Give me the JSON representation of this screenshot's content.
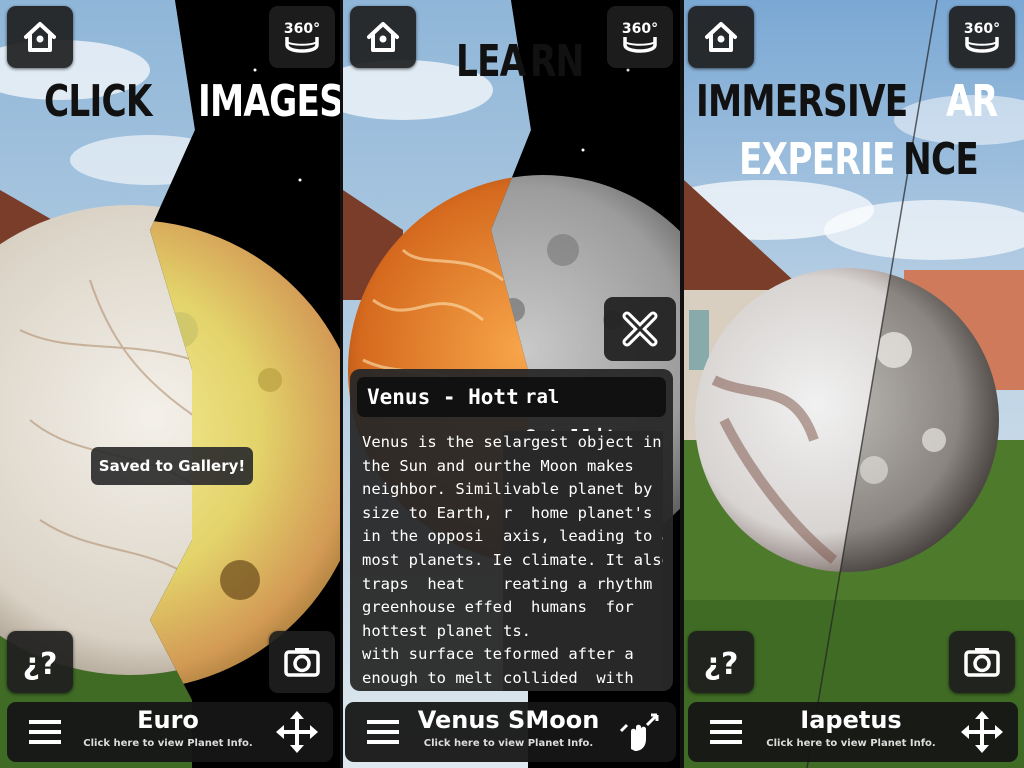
{
  "panels": [
    {
      "headline_left": "CLICK",
      "headline_right": "IMAGES",
      "toast": "Saved to Gallery!",
      "bar_title": "Euro",
      "bar_subtitle": "Click here to view Planet Info."
    },
    {
      "headline_left": "LEA",
      "headline_right": "RN",
      "info_title_left": "Venus - Hott",
      "info_title_right": "ral Satellite",
      "info_left_lines": "Venus is the sec\nthe Sun and our\nneighbor. Simila\nsize to Earth, \nin the opposi\nmost planets. It\ntraps  heat\ngreenhouse effe\nhottest planet in\nwith surface ten\nenough to melt lea",
      "info_right_lines": "largest object in\nthe Moon makes\nivable planet by\nr  home planet's\naxis, leading to a\ne climate. It also\nreating a rhythm\nd  humans  for\nts.\nformed after a\ncollided  with",
      "bar_title_left": "Venus S",
      "bar_title_right": "Moon",
      "bar_subtitle": "Click here to view Planet Info."
    },
    {
      "headline_left": "IMMERSIVE",
      "headline_right": "AR",
      "headline2_left": "EXPERIE",
      "headline2_right": "NCE",
      "bar_title": "Iapetus",
      "bar_subtitle": "Click here to view Planet Info."
    }
  ],
  "icons": {
    "home": "home-icon",
    "panorama": "360-view-icon",
    "help": "help-icon",
    "camera": "camera-icon",
    "menu": "menu-icon",
    "move": "move-icon",
    "pinch": "pinch-zoom-icon",
    "close": "close-icon"
  },
  "colors": {
    "button_bg": "#1e1e1e",
    "text_light": "#ffffff",
    "text_dark": "#111111"
  }
}
